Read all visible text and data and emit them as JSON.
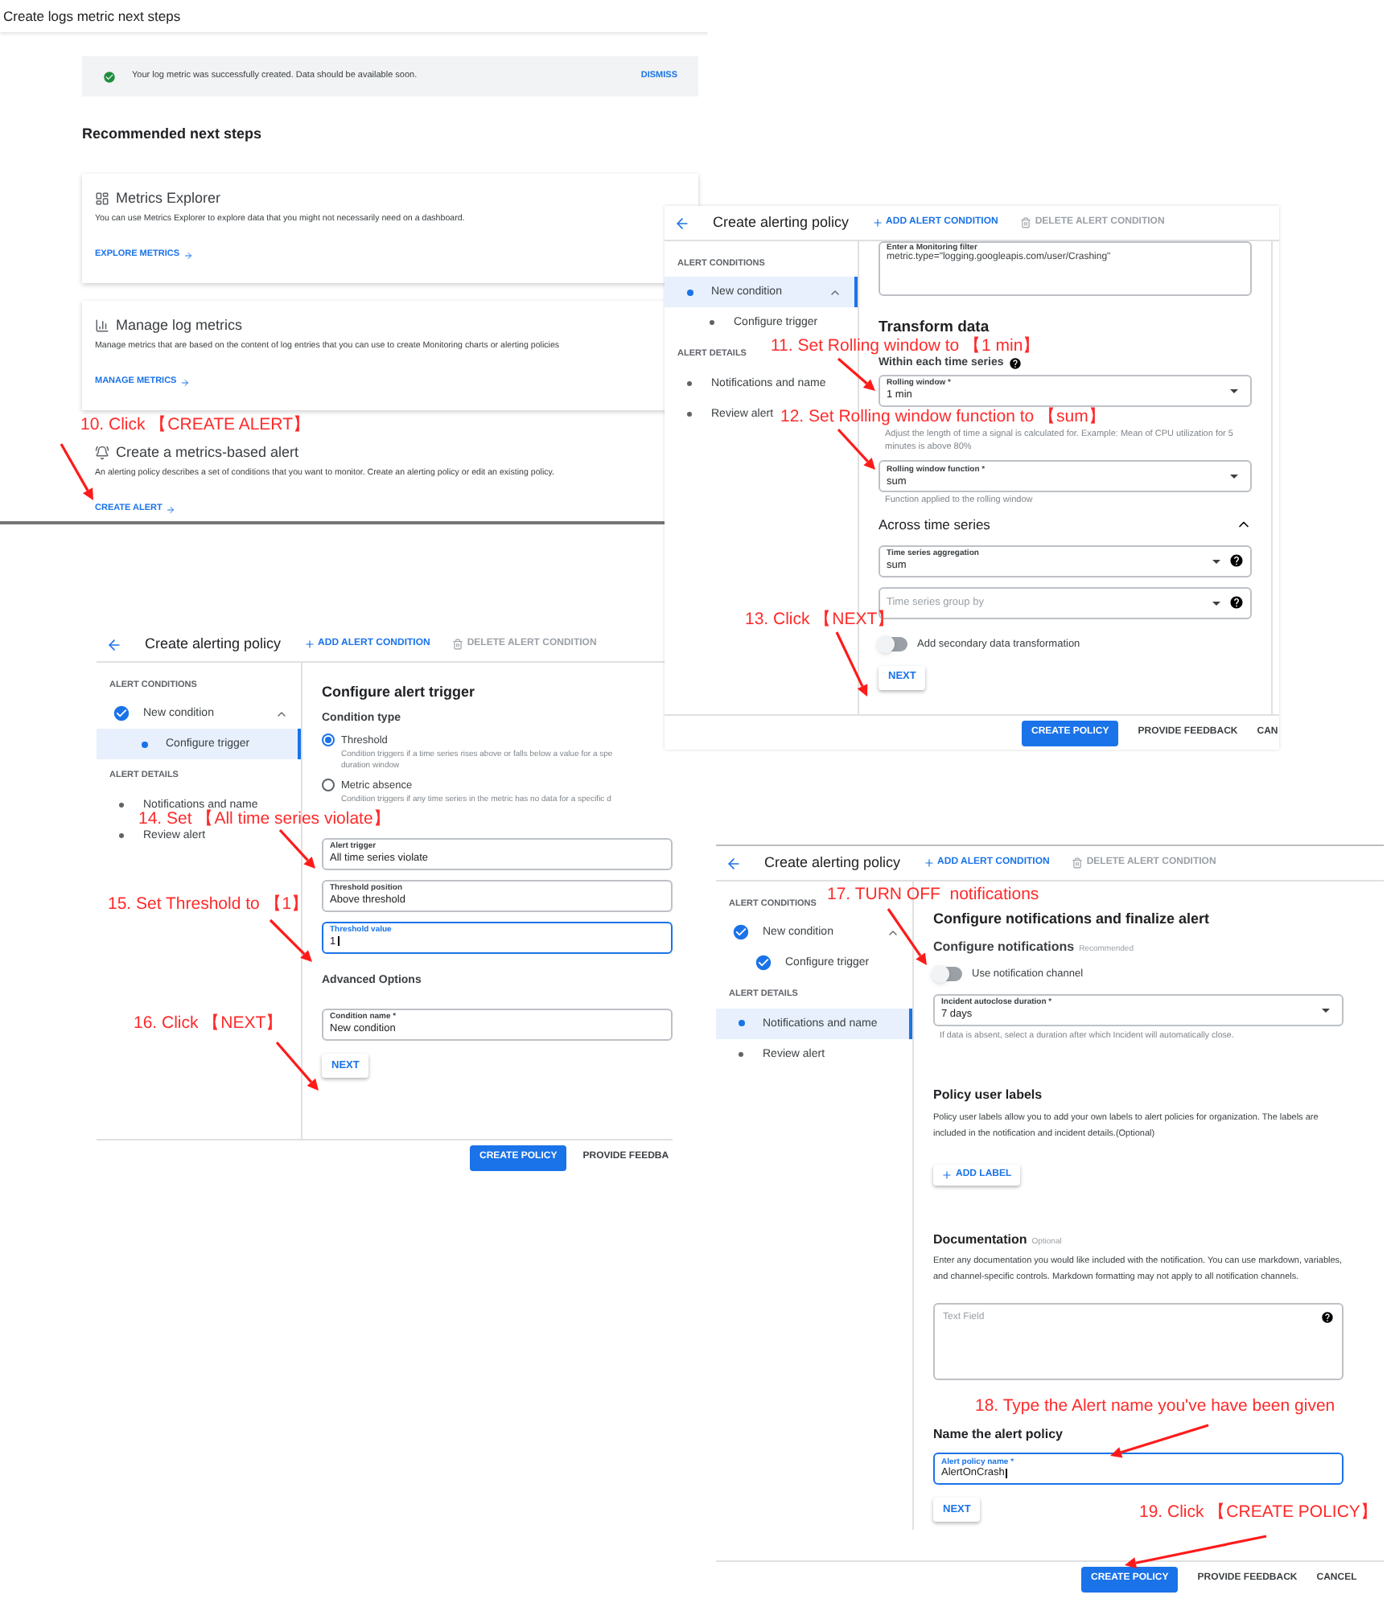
{
  "logs_metric_page": {
    "title": "Create logs metric next steps",
    "banner": {
      "message": "Your log metric was successfully created. Data should be available soon.",
      "action": "DISMISS"
    },
    "heading": "Recommended next steps",
    "cards": [
      {
        "kind": "explorer",
        "title": "Metrics Explorer",
        "description": "You can use Metrics Explorer to explore data that you might not necessarily need on a dashboard.",
        "link": "EXPLORE METRICS"
      },
      {
        "kind": "logs",
        "title": "Manage log metrics",
        "description": "Manage metrics that are based on the content of log entries that you can use to create Monitoring charts or alerting policies",
        "link": "MANAGE METRICS"
      },
      {
        "kind": "alert",
        "title": "Create a metrics-based alert",
        "description": "An alerting policy describes a set of conditions that you want to monitor. Create an alerting policy or edit an existing policy.",
        "link": "CREATE ALERT"
      }
    ]
  },
  "transform_step": {
    "header": {
      "title": "Create alerting policy",
      "add": "ADD ALERT CONDITION",
      "delete": "DELETE ALERT CONDITION"
    },
    "sidebar": [
      {
        "heading": "ALERT CONDITIONS",
        "items": [
          {
            "label": "New condition",
            "kind": "current",
            "selected": true,
            "expanded": true,
            "children": [
              {
                "label": "Configure trigger",
                "kind": "pending",
                "selected": false
              }
            ]
          }
        ]
      },
      {
        "heading": "ALERT DETAILS",
        "items": [
          {
            "label": "Notifications and name",
            "kind": "pending",
            "selected": false
          },
          {
            "label": "Review alert",
            "kind": "pending",
            "selected": false
          }
        ]
      }
    ],
    "filter": {
      "label": "Enter a Monitoring filter",
      "value": "metric.type=\"logging.googleapis.com/user/Crashing\""
    },
    "heading": "Transform data",
    "subheading": "Within each time series",
    "fields": [
      {
        "label": "Rolling window *",
        "value": "1 min",
        "help": "Adjust the length of time a signal is calculated for. Example: Mean of CPU utilization for 5 minutes is above 80%"
      },
      {
        "label": "Rolling window function *",
        "value": "sum",
        "help": "Function applied to the rolling window"
      }
    ],
    "across": {
      "title": "Across time series",
      "expanded": true,
      "fields": [
        {
          "label": "Time series aggregation",
          "value": "sum"
        },
        {
          "placeholder": "Time series group by"
        }
      ]
    },
    "toggle": {
      "label": "Add secondary data transformation",
      "on": false
    },
    "next": "NEXT",
    "footer": [
      {
        "label": "CREATE POLICY",
        "kind": "primary"
      },
      {
        "label": "PROVIDE FEEDBACK",
        "kind": "text"
      },
      {
        "label": "CAN",
        "kind": "text"
      }
    ]
  },
  "trigger_step": {
    "header": {
      "title": "Create alerting policy",
      "add": "ADD ALERT CONDITION",
      "delete": "DELETE ALERT CONDITION"
    },
    "sidebar": [
      {
        "heading": "ALERT CONDITIONS",
        "items": [
          {
            "label": "New condition",
            "kind": "done",
            "selected": false,
            "expanded": true,
            "children": [
              {
                "label": "Configure trigger",
                "kind": "current",
                "selected": true
              }
            ]
          }
        ]
      },
      {
        "heading": "ALERT DETAILS",
        "items": [
          {
            "label": "Notifications and name",
            "kind": "pending",
            "selected": false
          },
          {
            "label": "Review alert",
            "kind": "pending",
            "selected": false
          }
        ]
      }
    ],
    "heading": "Configure alert trigger",
    "condition_type": "Condition type",
    "options": [
      {
        "label": "Threshold",
        "selected": true,
        "description": [
          "Condition triggers if a time series rises above or falls below a value for a spe",
          "duration window"
        ]
      },
      {
        "label": "Metric absence",
        "selected": false,
        "description": [
          "Condition triggers if any time series in the metric has no data for a specific d"
        ]
      }
    ],
    "fields": [
      {
        "label": "Alert trigger",
        "value": "All time series violate",
        "focused": false
      },
      {
        "label": "Threshold position",
        "value": "Above threshold",
        "focused": false
      },
      {
        "label": "Threshold value",
        "value": "1",
        "focused": true
      }
    ],
    "advanced": "Advanced Options",
    "condition_field": {
      "label": "Condition name *",
      "value": "New condition",
      "focused": false
    },
    "next": "NEXT",
    "footer": [
      {
        "label": "CREATE POLICY",
        "kind": "primary"
      },
      {
        "label": "PROVIDE FEEDBA",
        "kind": "text"
      }
    ]
  },
  "notifications_step": {
    "header": {
      "title": "Create alerting policy",
      "add": "ADD ALERT CONDITION",
      "delete": "DELETE ALERT CONDITION"
    },
    "sidebar": [
      {
        "heading": "ALERT CONDITIONS",
        "items": [
          {
            "label": "New condition",
            "kind": "done",
            "selected": false,
            "expanded": true,
            "children": [
              {
                "label": "Configure trigger",
                "kind": "done",
                "selected": false
              }
            ]
          }
        ]
      },
      {
        "heading": "ALERT DETAILS",
        "items": [
          {
            "label": "Notifications and name",
            "kind": "current",
            "selected": true
          },
          {
            "label": "Review alert",
            "kind": "pending",
            "selected": false
          }
        ]
      }
    ],
    "heading": "Configure notifications and finalize alert",
    "notifications_title": "Configure notifications",
    "notifications_note": "Recommended",
    "toggle": {
      "label": "Use notification channel",
      "on": false
    },
    "autoclose": {
      "label": "Incident autoclose duration *",
      "value": "7 days",
      "help": "If data is absent, select a duration after which Incident will automatically close."
    },
    "labels_heading": "Policy user labels",
    "labels_text": "Policy user labels allow you to add your own labels to alert policies for organization. The labels are included in the notification and incident details.(Optional)",
    "add_label": "ADD LABEL",
    "doc_heading": "Documentation",
    "doc_note": "Optional",
    "doc_text": "Enter any documentation you would like included with the notification. You can use markdown, variables, and channel-specific controls. Markdown formatting may not apply to all notification channels.",
    "doc_field": {
      "placeholder": "Text Field"
    },
    "name_heading": "Name the alert policy",
    "name_field": {
      "label": "Alert policy name *",
      "value": "AlertOnCrash",
      "focused": true
    },
    "next": "NEXT",
    "footer": [
      {
        "label": "CREATE POLICY",
        "kind": "primary"
      },
      {
        "label": "PROVIDE FEEDBACK",
        "kind": "text"
      },
      {
        "label": "CANCEL",
        "kind": "text"
      }
    ]
  },
  "annotations": [
    {
      "text": "10. Click 【CREATE ALERT】"
    },
    {
      "text": "11. Set Rolling window to 【1 min】"
    },
    {
      "text": "12. Set Rolling window function to 【sum】"
    },
    {
      "text": "13. Click 【NEXT】"
    },
    {
      "text": "14. Set 【All time series violate】"
    },
    {
      "text": "15. Set Threshold to 【1】"
    },
    {
      "text": "16. Click 【NEXT】"
    },
    {
      "text": "17. TURN OFF  notifications"
    },
    {
      "text": "18. Type the Alert name you've have been given"
    },
    {
      "text": "19. Click 【CREATE POLICY】"
    }
  ]
}
